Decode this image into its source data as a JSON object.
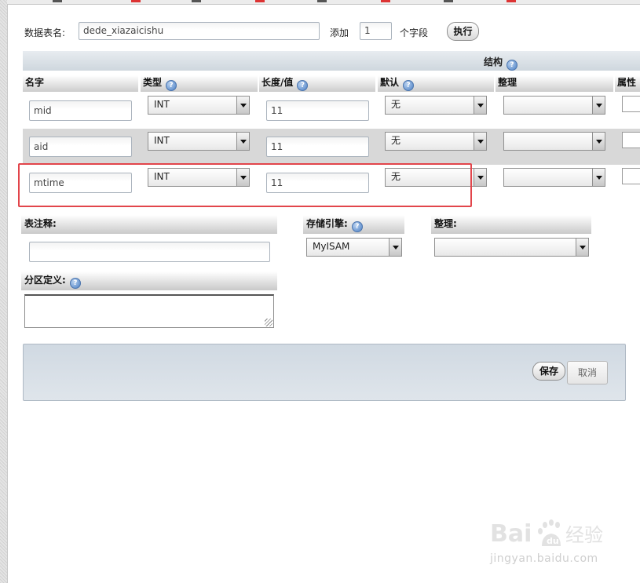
{
  "table_name": {
    "label": "数据表名:",
    "value": "dede_xiazaicishu"
  },
  "add_fields": {
    "label": "添加",
    "count": "1",
    "unit": "个字段",
    "execute": "执行"
  },
  "structure": {
    "title": "结构",
    "columns": {
      "name": "名字",
      "type": "类型",
      "length": "长度/值",
      "default": "默认",
      "collation": "整理",
      "attributes": "属性"
    }
  },
  "rows": [
    {
      "name": "mid",
      "type": "INT",
      "length": "11",
      "default": "无",
      "collation": ""
    },
    {
      "name": "aid",
      "type": "INT",
      "length": "11",
      "default": "无",
      "collation": ""
    },
    {
      "name": "mtime",
      "type": "INT",
      "length": "11",
      "default": "无",
      "collation": ""
    }
  ],
  "table_comment": {
    "label": "表注释:",
    "value": ""
  },
  "storage_engine": {
    "label": "存储引擎:",
    "value": "MyISAM"
  },
  "table_collation": {
    "label": "整理:",
    "value": ""
  },
  "partition": {
    "label": "分区定义:",
    "value": ""
  },
  "actions": {
    "save": "保存",
    "cancel": "取消"
  },
  "watermark": {
    "brand": "Bai 经验",
    "url": "jingyan.baidu.com"
  },
  "colors": {
    "highlight": "#e2454b",
    "panel": "#d3dce5",
    "header_band": "#dde3ea"
  }
}
